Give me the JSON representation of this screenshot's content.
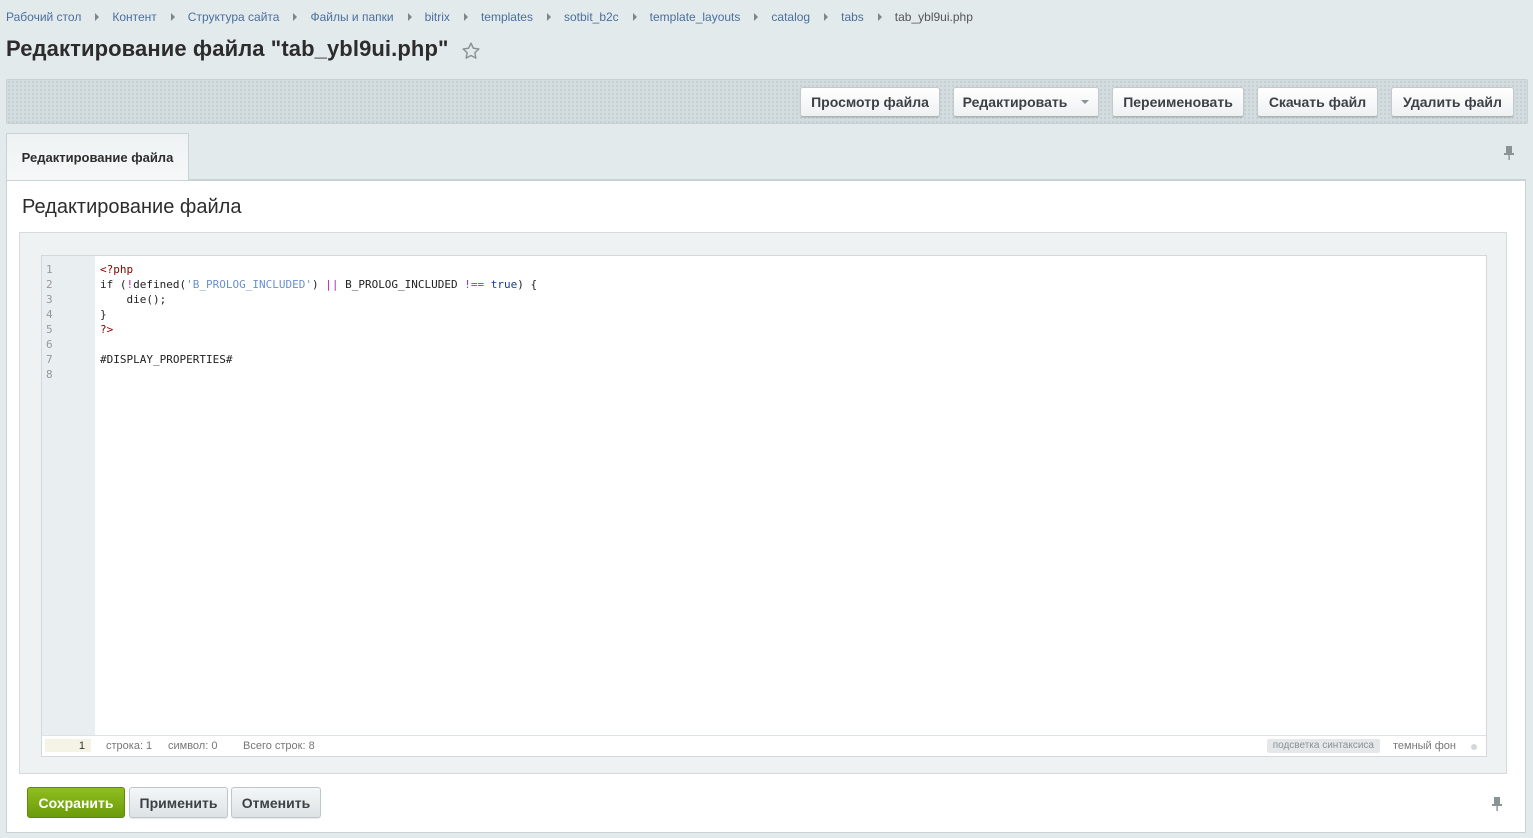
{
  "breadcrumbs": [
    "Рабочий стол",
    "Контент",
    "Структура сайта",
    "Файлы и папки",
    "bitrix",
    "templates",
    "sotbit_b2c",
    "template_layouts",
    "catalog",
    "tabs",
    "tab_ybl9ui.php"
  ],
  "page_title": "Редактирование файла \"tab_ybl9ui.php\"",
  "toolbar": {
    "view": "Просмотр файла",
    "edit": "Редактировать",
    "rename": "Переименовать",
    "download": "Скачать файл",
    "delete": "Удалить файл"
  },
  "tab_label": "Редактирование файла",
  "section_title": "Редактирование файла",
  "editor": {
    "lines": [
      {
        "no": "1",
        "tokens": [
          {
            "t": "<?php",
            "c": "t-tag"
          }
        ]
      },
      {
        "no": "2",
        "tokens": [
          {
            "t": "if (",
            "c": ""
          },
          {
            "t": "!",
            "c": "t-op"
          },
          {
            "t": "defined(",
            "c": ""
          },
          {
            "t": "'B_PROLOG_INCLUDED'",
            "c": "t-str"
          },
          {
            "t": ") ",
            "c": ""
          },
          {
            "t": "||",
            "c": "t-op"
          },
          {
            "t": " B_PROLOG_INCLUDED ",
            "c": ""
          },
          {
            "t": "!==",
            "c": "t-op"
          },
          {
            "t": " ",
            "c": ""
          },
          {
            "t": "true",
            "c": "t-kw"
          },
          {
            "t": ") {",
            "c": ""
          }
        ]
      },
      {
        "no": "3",
        "tokens": [
          {
            "t": "    die();",
            "c": ""
          }
        ]
      },
      {
        "no": "4",
        "tokens": [
          {
            "t": "}",
            "c": ""
          }
        ]
      },
      {
        "no": "5",
        "tokens": [
          {
            "t": "?>",
            "c": "t-tag"
          }
        ]
      },
      {
        "no": "6",
        "tokens": []
      },
      {
        "no": "7",
        "tokens": [
          {
            "t": "#DISPLAY_PROPERTIES#",
            "c": ""
          }
        ]
      },
      {
        "no": "8",
        "tokens": []
      }
    ],
    "status": {
      "current_line": "1",
      "line_label": "строка: 1",
      "char_label": "символ: 0",
      "total_label": "Всего строк: 8",
      "highlight_label": "подсветка синтаксиса",
      "dark_label": "темный фон"
    }
  },
  "buttons": {
    "save": "Сохранить",
    "apply": "Применить",
    "cancel": "Отменить"
  }
}
